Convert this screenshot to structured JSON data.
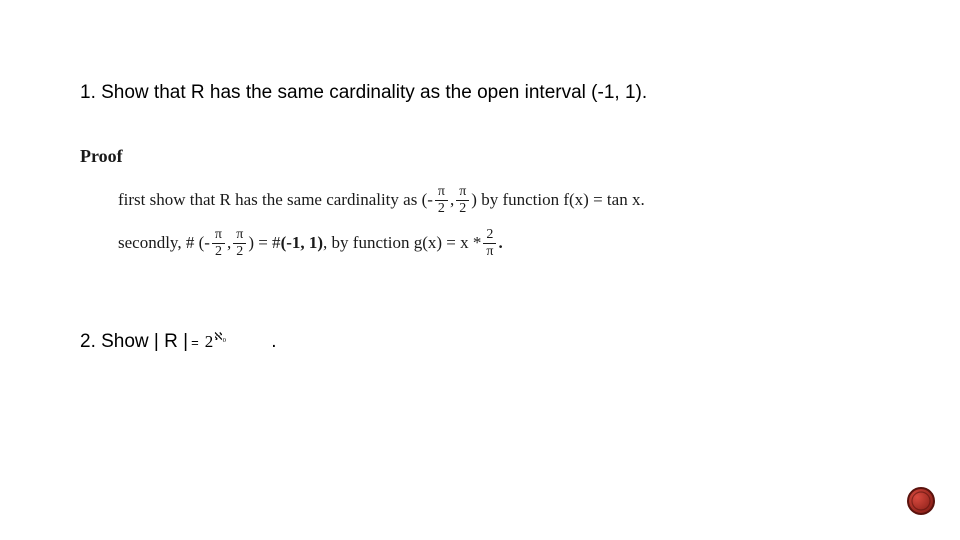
{
  "q1": "1. Show that R has the same cardinality as the open interval (-1, 1).",
  "proof_label": "Proof",
  "line1": {
    "a": "first show that R has the same cardinality as (-",
    "pi": "π",
    "two": "2",
    "mid": ", ",
    "b": ") by function f(x) = tan x."
  },
  "line2": {
    "a": "secondly, # (-",
    "pi": "π",
    "two": "2",
    "mid": ", ",
    "eq": ")  = # ",
    "interval": "(-1, 1)",
    "by": ", by function g(x) = x * ",
    "twotop": "2",
    "pibot": "π",
    "end": "."
  },
  "q2_prefix": "2. Show | R | ",
  "q2_eq": "=",
  "q2_base": "2",
  "q2_exp": "ℵ₀",
  "q2_period": "."
}
